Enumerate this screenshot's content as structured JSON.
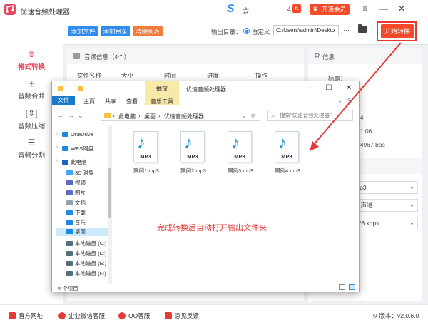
{
  "titlebar": {
    "app_name": "优速音频处理器",
    "s_logo": "S",
    "user_label": "会",
    "count": "4",
    "count_badge": "K",
    "vip_label": "开通会员",
    "crown_icon": "♛",
    "menu_icon": "≡",
    "minimize_icon": "—",
    "close_icon": "✕"
  },
  "sidebar": {
    "items": [
      {
        "icon": "⊜",
        "label": "格式转换",
        "active": true
      },
      {
        "icon": "⊞",
        "label": "音频合并"
      },
      {
        "icon": "[⇕]",
        "label": "音频压缩"
      },
      {
        "icon": "☰",
        "label": "音频分割"
      }
    ]
  },
  "toolbar": {
    "add_file": "添加文件",
    "add_dir": "添加目录",
    "clear_list": "清除列表",
    "output_label": "输出目录：",
    "custom_label": "自定义",
    "path_value": "C:\\Users\\admin\\Deskto",
    "dots_label": "···",
    "start_label": "开始转换"
  },
  "panel_left": {
    "title": "音频信息（4个）",
    "columns": [
      "文件名称",
      "大小",
      "时间",
      "进度",
      "操作"
    ]
  },
  "panel_right": {
    "title": "信息",
    "gear_icon": "⚙",
    "title_label": "标题：",
    "values": [
      "p4",
      "01:06",
      "44967 bps"
    ],
    "selects": [
      "mp3",
      "单声道",
      "128 kbps"
    ],
    "caret": "⌄"
  },
  "explorer": {
    "title": "优速音频处理器",
    "context_tab": "播放",
    "tabs": [
      "文件",
      "主页",
      "共享",
      "查看",
      "音乐工具"
    ],
    "breadcrumb": [
      "此电脑",
      "桌面",
      "优速音频处理器"
    ],
    "crumb_sep": "›",
    "search_placeholder": "搜索\"优速音频处理器\"",
    "search_icon": "⌕",
    "nav_icons": {
      "back": "←",
      "forward": "→",
      "recent": "⌄",
      "up": "↑",
      "dropdown": "⌄",
      "refresh": "⟳"
    },
    "window_icons": {
      "minimize": "—",
      "maximize": "☐",
      "close": "✕",
      "help": "?"
    },
    "tree": [
      {
        "label": "OneDrive",
        "color": "#1e88e5"
      },
      {
        "label": "WPS网盘",
        "color": "#1e88e5"
      },
      {
        "label": "此电脑",
        "color": "#1565c0"
      },
      {
        "label": "3D 对象",
        "color": "#42a5f5"
      },
      {
        "label": "视频",
        "color": "#5c6bc0"
      },
      {
        "label": "图片",
        "color": "#5c6bc0"
      },
      {
        "label": "文档",
        "color": "#90a4ae"
      },
      {
        "label": "下载",
        "color": "#1e88e5"
      },
      {
        "label": "音乐",
        "color": "#1e88e5"
      },
      {
        "label": "桌面",
        "color": "#1e88e5",
        "selected": true
      },
      {
        "label": "本地磁盘 (C:)",
        "color": "#546e7a"
      },
      {
        "label": "本地磁盘 (D:)",
        "color": "#546e7a"
      },
      {
        "label": "本地磁盘 (E:)",
        "color": "#546e7a"
      },
      {
        "label": "本地磁盘 (F:)",
        "color": "#546e7a"
      }
    ],
    "tree_chevron": "›",
    "files": [
      {
        "name": "案例1.mp3",
        "badge": "MP3",
        "icon": "♪"
      },
      {
        "name": "案例2.mp3",
        "badge": "MP3",
        "icon": "♪"
      },
      {
        "name": "案例3.mp3",
        "badge": "MP3",
        "icon": "♪"
      },
      {
        "name": "案例4.mp3",
        "badge": "MP3",
        "icon": "♪"
      }
    ],
    "status": "4 个项目"
  },
  "annotation": "完成转换后自动打开输出文件夹",
  "footer": {
    "items": [
      "官方网址",
      "企业微信客服",
      "QQ客服",
      "意见反馈"
    ],
    "version": "版本：v2.0.6.0",
    "refresh_icon": "↻"
  },
  "colors": {
    "accent_red": "#f44a2a",
    "blue": "#2d8cf0",
    "annotation_red": "#e53935",
    "brand_pink": "#e8455a"
  }
}
